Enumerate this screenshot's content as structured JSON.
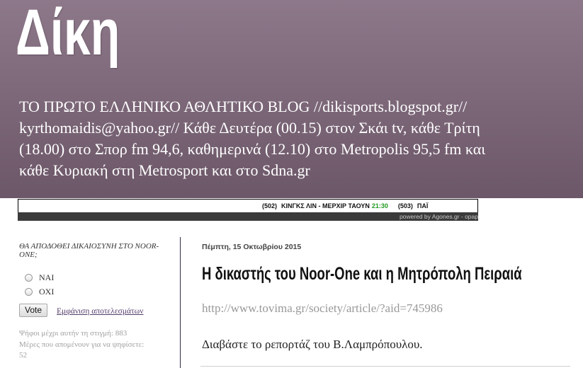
{
  "header": {
    "title": "Δίκη",
    "description_lines": [
      "ΤΟ ΠΡΩΤΟ ΕΛΛΗΝΙΚΟ ΑΘΛΗΤΙΚΟ BLOG //dikisports.blogspot.gr//",
      "kyrthomaidis@yahoo.gr// Κάθε Δευτέρα (00.15) στον Σκάι tv, κάθε Τρίτη",
      "(18.00) στο Σπορ fm 94,6, καθημερινά (12.10) στο Metropolis 95,5 fm και",
      "κάθε Κυριακή στη Metrosport και στο Sdna.gr"
    ]
  },
  "ticker": {
    "matches": [
      {
        "code": "(502)",
        "teams": "ΚΙΝΓΚΣ ΛΙΝ - ΜΕΡΧΙΡ ΤΑΟΥΝ",
        "time": "21:30"
      },
      {
        "code": "(503)",
        "teams": "ΠΑΪ"
      }
    ],
    "powered_by": "powered by Agones.gr - opap"
  },
  "sidebar": {
    "poll": {
      "question": "ΘΑ ΑΠΟΔΟΘΕΙ ΔΙΚΑΙΟΣΥΝΗ ΣΤΟ NOOR-ONE;",
      "options": [
        {
          "label": "ΝΑΙ",
          "selected": false
        },
        {
          "label": "ΟΧΙ",
          "selected": false
        }
      ],
      "vote_button": "Vote",
      "results_link": "Εμφάνιση αποτελεσμάτων",
      "votes_label": "Ψήφοι μέχρι αυτήν τη στιγμή:",
      "votes_count": "883",
      "days_label": "Μέρες που απομένουν για να ψηφίσετε:",
      "days_count": "52"
    }
  },
  "post": {
    "date": "Πέμπτη, 15 Οκτωβρίου 2015",
    "title": "Η δικαστής του Noor-One και η Μητρόπολη Πειραιά",
    "source_url_text": "http://www.tovima.gr/society/article/?aid=745986",
    "body": "Διαβάστε το ρεπορτάζ του Β.Λαμπρόπουλου."
  },
  "colors": {
    "header_top": "#8d788a",
    "header_bottom": "#6c5768",
    "ticker_time": "#1f9a1f",
    "poll_link": "#553d6b",
    "divider": "#2e2e48"
  }
}
